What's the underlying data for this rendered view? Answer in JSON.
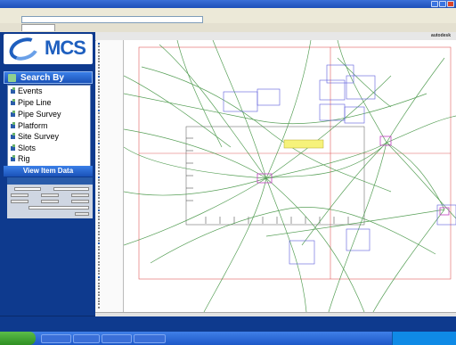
{
  "browser": {
    "title": "",
    "menus": [
      "",
      "",
      "",
      "",
      ""
    ],
    "address": "",
    "tab": ""
  },
  "logo": {
    "text": "MCS"
  },
  "search_panel": {
    "header": "Search By",
    "items": [
      {
        "label": "Events"
      },
      {
        "label": "Pipe Line"
      },
      {
        "label": "Pipe Survey"
      },
      {
        "label": "Platform"
      },
      {
        "label": "Site Survey"
      },
      {
        "label": "Slots"
      },
      {
        "label": "Rig"
      }
    ],
    "view_item_button": "View Item Data"
  },
  "map": {
    "brand": "autodesk",
    "highlight_label": ""
  },
  "colors": {
    "panel_bg": "#0e3a8e",
    "accent": "#1e5fbf",
    "pipe_lines": "#3a8f3a",
    "survey_boxes": "#5a5adc",
    "boundary": "#e05a5a"
  },
  "icons": [
    "bullet-icon",
    "search-icon",
    "windows-start-icon"
  ]
}
